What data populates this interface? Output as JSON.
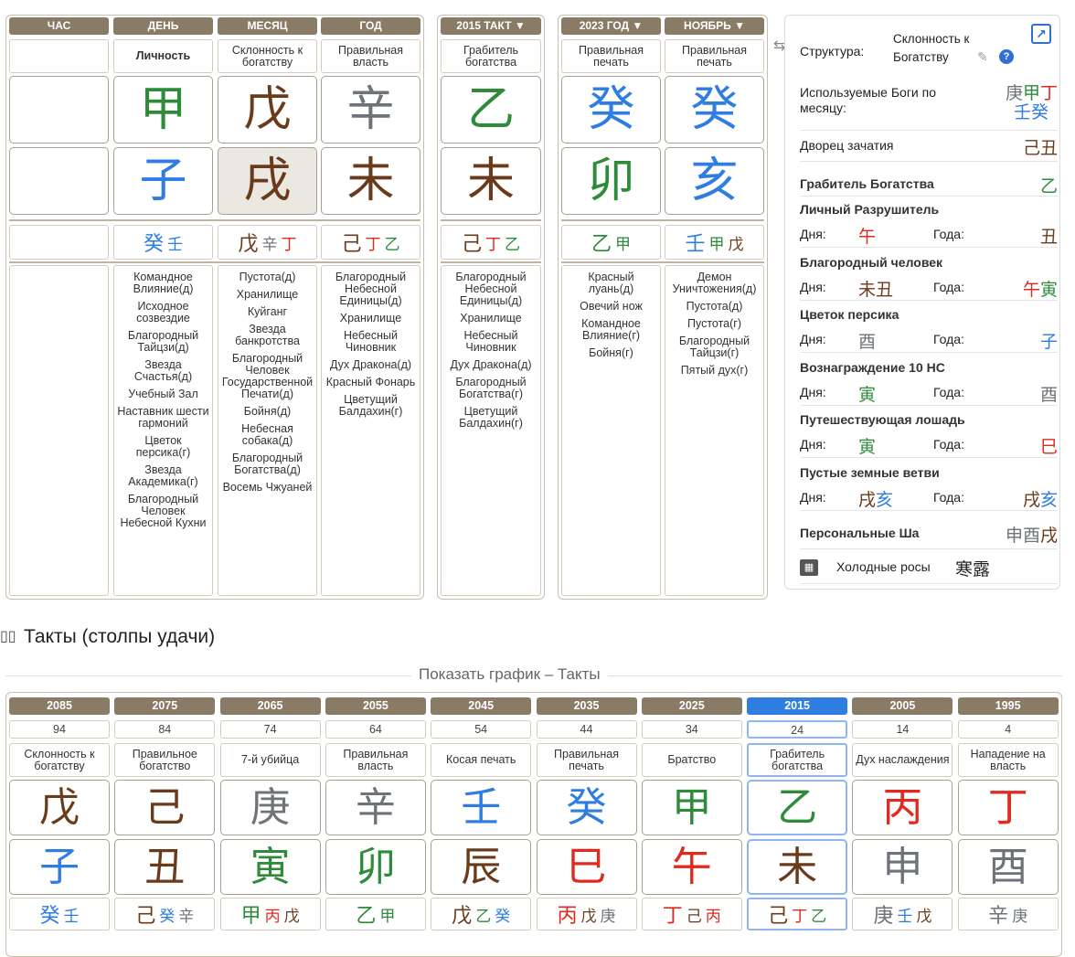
{
  "colors": {
    "wood": "#2e8b3a",
    "fire": "#e02a1f",
    "earth": "#6a3b1a",
    "metal": "#6e737a",
    "water": "#2f7de1",
    "header": "#8a7b67",
    "selected": "#2f7de1"
  },
  "natal": {
    "headers": [
      "ЧАС",
      "ДЕНЬ",
      "МЕСЯЦ",
      "ГОД"
    ],
    "gods": [
      "",
      "Личность",
      "Склонность к богатству",
      "Правильная власть"
    ],
    "stems": [
      {
        "c": "",
        "e": ""
      },
      {
        "c": "甲",
        "e": "wood"
      },
      {
        "c": "戊",
        "e": "earth"
      },
      {
        "c": "辛",
        "e": "metal"
      }
    ],
    "branches": [
      {
        "c": "",
        "e": ""
      },
      {
        "c": "子",
        "e": "water"
      },
      {
        "c": "戌",
        "e": "earth"
      },
      {
        "c": "未",
        "e": "earth"
      }
    ],
    "hidden": [
      [],
      [
        {
          "c": "癸",
          "e": "water"
        },
        {
          "c": "壬",
          "e": "water"
        }
      ],
      [
        {
          "c": "戊",
          "e": "earth"
        },
        {
          "c": "辛",
          "e": "metal"
        },
        {
          "c": "丁",
          "e": "fire"
        }
      ],
      [
        {
          "c": "己",
          "e": "earth"
        },
        {
          "c": "丁",
          "e": "fire"
        },
        {
          "c": "乙",
          "e": "wood"
        }
      ]
    ],
    "stars": [
      [],
      [
        "Командное Влияние(д)",
        "Исходное созвездие",
        "Благородный Тайцзи(д)",
        "Звезда Счастья(д)",
        "Учебный Зал",
        "Наставник шести гармоний",
        "Цветок персика(г)",
        "Звезда Академика(г)",
        "Благородный Человек Небесной Кухни"
      ],
      [
        "Пустота(д)",
        "Хранилище",
        "Куйганг",
        "Звезда банкротства",
        "Благородный Человек Государственной Печати(д)",
        "Бойня(д)",
        "Небесная собака(д)",
        "Благородный Богатства(д)",
        "Восемь Чжуаней"
      ],
      [
        "Благородный Небесной Единицы(д)",
        "Хранилище",
        "Небесный Чиновник",
        "Дух Дракона(д)",
        "Красный Фонарь",
        "Цветущий Балдахин(г)"
      ]
    ]
  },
  "luck": {
    "header": "2015 ТАКТ ▼",
    "god": "Грабитель богатства",
    "stem": {
      "c": "乙",
      "e": "wood"
    },
    "branch": {
      "c": "未",
      "e": "earth"
    },
    "hidden": [
      {
        "c": "己",
        "e": "earth"
      },
      {
        "c": "丁",
        "e": "fire"
      },
      {
        "c": "乙",
        "e": "wood"
      }
    ],
    "stars": [
      "Благородный Небесной Единицы(д)",
      "Хранилище",
      "Небесный Чиновник",
      "Дух Дракона(д)",
      "Благородный Богатства(г)",
      "Цветущий Балдахин(г)"
    ]
  },
  "annual": {
    "headers": [
      "2023 ГОД ▼",
      "НОЯБРЬ ▼"
    ],
    "gods": [
      "Правильная печать",
      "Правильная печать"
    ],
    "stems": [
      {
        "c": "癸",
        "e": "water"
      },
      {
        "c": "癸",
        "e": "water"
      }
    ],
    "branches": [
      {
        "c": "卯",
        "e": "wood"
      },
      {
        "c": "亥",
        "e": "water"
      }
    ],
    "hidden": [
      [
        {
          "c": "乙",
          "e": "wood"
        },
        {
          "c": "甲",
          "e": "wood"
        }
      ],
      [
        {
          "c": "壬",
          "e": "water"
        },
        {
          "c": "甲",
          "e": "wood"
        },
        {
          "c": "戊",
          "e": "earth"
        }
      ]
    ],
    "stars": [
      [
        "Красный луань(д)",
        "Овечий нож",
        "Командное Влияние(г)",
        "Бойня(г)"
      ],
      [
        "Демон Уничтожения(д)",
        "Пустота(д)",
        "Пустота(г)",
        "Благородный Тайцзи(г)",
        "Пятый дух(г)"
      ]
    ]
  },
  "right": {
    "structure_label": "Структура:",
    "structure_value": "Склонность к Богатству",
    "useful_gods_label": "Используемые Боги по месяцу:",
    "useful_gods": [
      {
        "c": "庚",
        "e": "metal"
      },
      {
        "c": "甲",
        "e": "wood"
      },
      {
        "c": "丁",
        "e": "fire"
      },
      {
        "c": "壬",
        "e": "water"
      },
      {
        "c": "癸",
        "e": "water"
      }
    ],
    "conception_label": "Дворец зачатия",
    "conception": [
      {
        "c": "己",
        "e": "earth"
      },
      {
        "c": "丑",
        "e": "earth"
      }
    ],
    "rob_label": "Грабитель Богатства",
    "rob": {
      "c": "乙",
      "e": "wood"
    },
    "day_label": "Дня:",
    "year_label": "Года:",
    "sections": [
      {
        "title": "Личный Разрушитель",
        "day": [
          {
            "c": "午",
            "e": "fire"
          }
        ],
        "year": [
          {
            "c": "丑",
            "e": "earth"
          }
        ]
      },
      {
        "title": "Благородный человек",
        "day": [
          {
            "c": "未",
            "e": "earth"
          },
          {
            "c": "丑",
            "e": "earth"
          }
        ],
        "year": [
          {
            "c": "午",
            "e": "fire"
          },
          {
            "c": "寅",
            "e": "wood"
          }
        ]
      },
      {
        "title": "Цветок персика",
        "day": [
          {
            "c": "酉",
            "e": "metal"
          }
        ],
        "year": [
          {
            "c": "子",
            "e": "water"
          }
        ]
      },
      {
        "title": "Вознаграждение 10 НС",
        "day": [
          {
            "c": "寅",
            "e": "wood"
          }
        ],
        "year": [
          {
            "c": "酉",
            "e": "metal"
          }
        ]
      },
      {
        "title": "Путешествующая лошадь",
        "day": [
          {
            "c": "寅",
            "e": "wood"
          }
        ],
        "year": [
          {
            "c": "巳",
            "e": "fire"
          }
        ]
      },
      {
        "title": "Пустые земные ветви",
        "day": [
          {
            "c": "戌",
            "e": "earth"
          },
          {
            "c": "亥",
            "e": "water"
          }
        ],
        "year": [
          {
            "c": "戌",
            "e": "earth"
          },
          {
            "c": "亥",
            "e": "water"
          }
        ]
      }
    ],
    "personal_sha_label": "Персональные Ша",
    "personal_sha": [
      {
        "c": "申",
        "e": "metal"
      },
      {
        "c": "酉",
        "e": "metal"
      },
      {
        "c": "戌",
        "e": "earth"
      }
    ],
    "solar_term_label": "Холодные росы",
    "solar_term_hanzi": "寒露"
  },
  "lucks_section": {
    "title": "Такты (столпы удачи)",
    "show_chart": "Показать график – Такты",
    "columns": [
      {
        "year": "2085",
        "age": "94",
        "god": "Склонность к богатству",
        "stem": {
          "c": "戊",
          "e": "earth"
        },
        "branch": {
          "c": "子",
          "e": "water"
        },
        "hidden": [
          {
            "c": "癸",
            "e": "water"
          },
          {
            "c": "壬",
            "e": "water"
          }
        ]
      },
      {
        "year": "2075",
        "age": "84",
        "god": "Правильное богатство",
        "stem": {
          "c": "己",
          "e": "earth"
        },
        "branch": {
          "c": "丑",
          "e": "earth"
        },
        "hidden": [
          {
            "c": "己",
            "e": "earth"
          },
          {
            "c": "癸",
            "e": "water"
          },
          {
            "c": "辛",
            "e": "metal"
          }
        ]
      },
      {
        "year": "2065",
        "age": "74",
        "god": "7-й убийца",
        "stem": {
          "c": "庚",
          "e": "metal"
        },
        "branch": {
          "c": "寅",
          "e": "wood"
        },
        "hidden": [
          {
            "c": "甲",
            "e": "wood"
          },
          {
            "c": "丙",
            "e": "fire"
          },
          {
            "c": "戊",
            "e": "earth"
          }
        ]
      },
      {
        "year": "2055",
        "age": "64",
        "god": "Правильная власть",
        "stem": {
          "c": "辛",
          "e": "metal"
        },
        "branch": {
          "c": "卯",
          "e": "wood"
        },
        "hidden": [
          {
            "c": "乙",
            "e": "wood"
          },
          {
            "c": "甲",
            "e": "wood"
          }
        ]
      },
      {
        "year": "2045",
        "age": "54",
        "god": "Косая печать",
        "stem": {
          "c": "壬",
          "e": "water"
        },
        "branch": {
          "c": "辰",
          "e": "earth"
        },
        "hidden": [
          {
            "c": "戊",
            "e": "earth"
          },
          {
            "c": "乙",
            "e": "wood"
          },
          {
            "c": "癸",
            "e": "water"
          }
        ]
      },
      {
        "year": "2035",
        "age": "44",
        "god": "Правильная печать",
        "stem": {
          "c": "癸",
          "e": "water"
        },
        "branch": {
          "c": "巳",
          "e": "fire"
        },
        "hidden": [
          {
            "c": "丙",
            "e": "fire"
          },
          {
            "c": "戊",
            "e": "earth"
          },
          {
            "c": "庚",
            "e": "metal"
          }
        ]
      },
      {
        "year": "2025",
        "age": "34",
        "god": "Братство",
        "stem": {
          "c": "甲",
          "e": "wood"
        },
        "branch": {
          "c": "午",
          "e": "fire"
        },
        "hidden": [
          {
            "c": "丁",
            "e": "fire"
          },
          {
            "c": "己",
            "e": "earth"
          },
          {
            "c": "丙",
            "e": "fire"
          }
        ]
      },
      {
        "year": "2015",
        "age": "24",
        "god": "Грабитель богатства",
        "stem": {
          "c": "乙",
          "e": "wood"
        },
        "branch": {
          "c": "未",
          "e": "earth"
        },
        "hidden": [
          {
            "c": "己",
            "e": "earth"
          },
          {
            "c": "丁",
            "e": "fire"
          },
          {
            "c": "乙",
            "e": "wood"
          }
        ],
        "selected": true
      },
      {
        "year": "2005",
        "age": "14",
        "god": "Дух наслаждения",
        "stem": {
          "c": "丙",
          "e": "fire"
        },
        "branch": {
          "c": "申",
          "e": "metal"
        },
        "hidden": [
          {
            "c": "庚",
            "e": "metal"
          },
          {
            "c": "壬",
            "e": "water"
          },
          {
            "c": "戊",
            "e": "earth"
          }
        ]
      },
      {
        "year": "1995",
        "age": "4",
        "god": "Нападение на власть",
        "stem": {
          "c": "丁",
          "e": "fire"
        },
        "branch": {
          "c": "酉",
          "e": "metal"
        },
        "hidden": [
          {
            "c": "辛",
            "e": "metal"
          },
          {
            "c": "庚",
            "e": "metal"
          }
        ]
      }
    ]
  }
}
